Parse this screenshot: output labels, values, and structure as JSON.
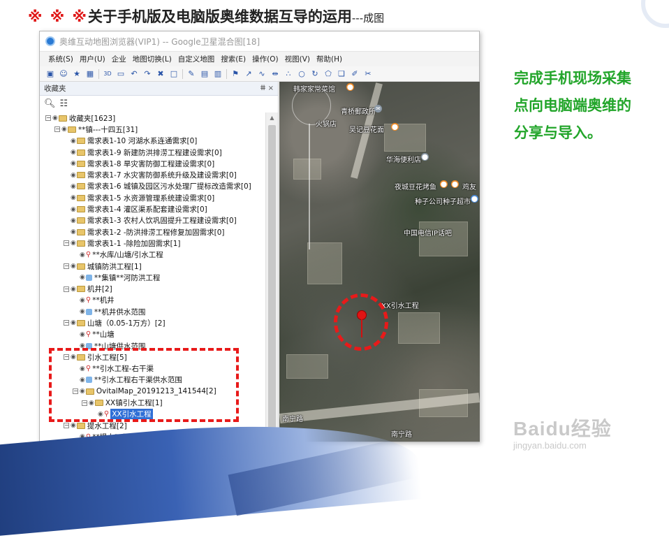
{
  "slide": {
    "title_marks": "※ ※ ※",
    "title_main": "关于手机版及电脑版奥维数据互导的运用",
    "title_suffix": "---成图",
    "caption_lines": [
      "完成手机现场采集",
      "点向电脑端奥维的",
      "分享与导入。"
    ],
    "watermark_line1": "Baidu经验",
    "watermark_line2": "jingyan.baidu.com",
    "colors": {
      "caption": "#22a52a",
      "title_marks": "#e01818",
      "highlight": "#e81a1a"
    }
  },
  "app": {
    "title": "奥维互动地图浏览器(VIP1) -- Google卫星混合图[18]",
    "menu": [
      "系统(S)",
      "用户(U)",
      "企业",
      "地图切换(L)",
      "自定义地图",
      "搜索(E)",
      "操作(O)",
      "视图(V)",
      "帮助(H)"
    ],
    "toolbar_icons": [
      "save-icon",
      "user-icon",
      "star-icon",
      "grid-icon",
      "3d-icon",
      "2d-icon",
      "undo-icon",
      "redo-icon",
      "trash-icon",
      "rect-icon",
      "pen-icon",
      "doc-icon",
      "layer-icon",
      "marker-icon",
      "line-icon",
      "curve-icon",
      "measure-icon",
      "points-icon",
      "circle-icon",
      "refresh-icon",
      "polygon-icon",
      "bookmark-icon",
      "edit-icon",
      "cut-icon"
    ]
  },
  "panel": {
    "title": "收藏夹",
    "pin_label": "ⵌ ×",
    "tree": [
      {
        "indent": 0,
        "exp": "−",
        "type": "folder",
        "label": "收藏夹[1623]"
      },
      {
        "indent": 1,
        "exp": "−",
        "type": "folder",
        "label": "**镇---十四五[31]"
      },
      {
        "indent": 2,
        "exp": "",
        "type": "folder",
        "label": "需求表1-10 河湖水系连通需求[0]"
      },
      {
        "indent": 2,
        "exp": "",
        "type": "folder",
        "label": "需求表1-9 新建防洪排涝工程建设需求[0]"
      },
      {
        "indent": 2,
        "exp": "",
        "type": "folder",
        "label": "需求表1-8 旱灾害防御工程建设需求[0]"
      },
      {
        "indent": 2,
        "exp": "",
        "type": "folder",
        "label": "需求表1-7 水灾害防御系统升级及建设需求[0]"
      },
      {
        "indent": 2,
        "exp": "",
        "type": "folder",
        "label": "需求表1-6 城镇及园区污水处理厂提标改造需求[0]"
      },
      {
        "indent": 2,
        "exp": "",
        "type": "folder",
        "label": "需求表1-5 水资源管理系统建设需求[0]"
      },
      {
        "indent": 2,
        "exp": "",
        "type": "folder",
        "label": "需求表1-4 灌区渠系配套建设需求[0]"
      },
      {
        "indent": 2,
        "exp": "",
        "type": "folder",
        "label": "需求表1-3 农村人饮巩固提升工程建设需求[0]"
      },
      {
        "indent": 2,
        "exp": "",
        "type": "folder",
        "label": "需求表1-2 -防洪排涝工程修复加固需求[0]"
      },
      {
        "indent": 2,
        "exp": "−",
        "type": "folder",
        "label": "需求表1-1 -除险加固需求[1]"
      },
      {
        "indent": 3,
        "exp": "",
        "type": "pin",
        "label": "**水库/山塘/引水工程"
      },
      {
        "indent": 2,
        "exp": "−",
        "type": "folder",
        "label": "城镇防洪工程[1]"
      },
      {
        "indent": 3,
        "exp": "",
        "type": "poly",
        "label": "**集镇**河防洪工程"
      },
      {
        "indent": 2,
        "exp": "−",
        "type": "folder",
        "label": "机井[2]"
      },
      {
        "indent": 3,
        "exp": "",
        "type": "pin",
        "label": "**机井"
      },
      {
        "indent": 3,
        "exp": "",
        "type": "poly",
        "label": "**机井供水范围"
      },
      {
        "indent": 2,
        "exp": "−",
        "type": "folder",
        "label": "山塘（0.05-1万方）[2]"
      },
      {
        "indent": 3,
        "exp": "",
        "type": "pin",
        "label": "**山塘"
      },
      {
        "indent": 3,
        "exp": "",
        "type": "poly",
        "label": "**山塘供水范围"
      },
      {
        "indent": 2,
        "exp": "−",
        "type": "folder",
        "label": "引水工程[5]"
      },
      {
        "indent": 3,
        "exp": "",
        "type": "pin",
        "label": "**引水工程-右干渠"
      },
      {
        "indent": 3,
        "exp": "",
        "type": "poly",
        "label": "**引水工程右干渠供水范围"
      },
      {
        "indent": 3,
        "exp": "−",
        "type": "folder",
        "label": "OvitalMap_20191213_141544[2]"
      },
      {
        "indent": 4,
        "exp": "−",
        "type": "folder",
        "label": "XX镇引水工程[1]"
      },
      {
        "indent": 5,
        "exp": "",
        "type": "pin",
        "label": "XX引水工程",
        "selected": true
      },
      {
        "indent": 2,
        "exp": "−",
        "type": "folder",
        "label": "提水工程[2]"
      },
      {
        "indent": 3,
        "exp": "",
        "type": "pin",
        "label": "**提水工程"
      }
    ]
  },
  "map": {
    "labels": [
      {
        "text": "韩家家常菜馆",
        "icon": "orange"
      },
      {
        "text": "青桥郵政所",
        "icon": "grey"
      },
      {
        "text": "火锅店",
        "icon": ""
      },
      {
        "text": "吴记豆花面",
        "icon": "orange"
      },
      {
        "text": "华海便利店",
        "icon": "grey"
      },
      {
        "text": "夜城豆花烤鱼",
        "icon": "orange"
      },
      {
        "text": "鸡友",
        "icon": "orange"
      },
      {
        "text": "种子公司种子超市",
        "icon": "blue"
      },
      {
        "text": "中国电信IP话吧",
        "icon": ""
      },
      {
        "text": "XX引水工程",
        "icon": ""
      },
      {
        "text": "南宁路",
        "icon": ""
      },
      {
        "text": "南宁路",
        "icon": ""
      }
    ]
  }
}
